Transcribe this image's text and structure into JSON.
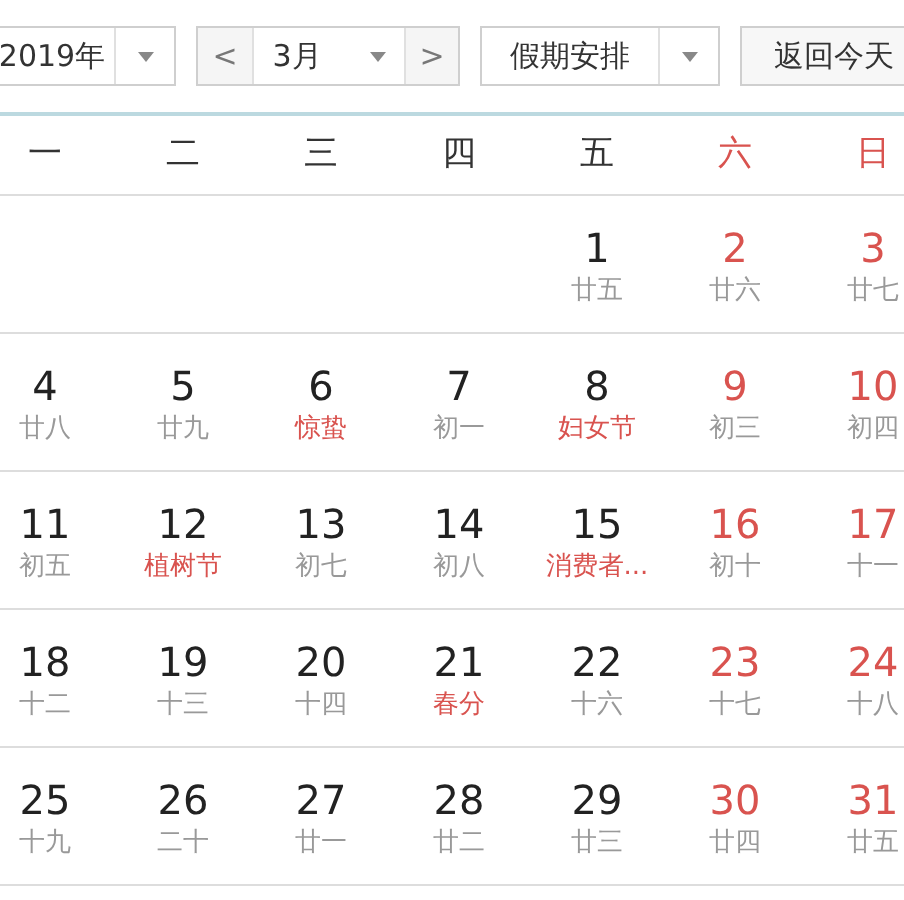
{
  "toolbar": {
    "year": "2019年",
    "prev": "<",
    "month": "3月",
    "next": ">",
    "holiday_select": "假期安排",
    "today_button": "返回今天"
  },
  "weekdays": [
    {
      "label": "一",
      "weekend": false
    },
    {
      "label": "二",
      "weekend": false
    },
    {
      "label": "三",
      "weekend": false
    },
    {
      "label": "四",
      "weekend": false
    },
    {
      "label": "五",
      "weekend": false
    },
    {
      "label": "六",
      "weekend": true
    },
    {
      "label": "日",
      "weekend": true
    }
  ],
  "weeks": [
    [
      {
        "kind": "blank"
      },
      {
        "kind": "blank"
      },
      {
        "kind": "blank"
      },
      {
        "kind": "blank"
      },
      {
        "kind": "day",
        "day": "1",
        "lunar": "廿五",
        "weekend": false,
        "festival": false
      },
      {
        "kind": "day",
        "day": "2",
        "lunar": "廿六",
        "weekend": true,
        "festival": false
      },
      {
        "kind": "day",
        "day": "3",
        "lunar": "廿七",
        "weekend": true,
        "festival": false
      }
    ],
    [
      {
        "kind": "day",
        "day": "4",
        "lunar": "廿八",
        "weekend": false,
        "festival": false
      },
      {
        "kind": "day",
        "day": "5",
        "lunar": "廿九",
        "weekend": false,
        "festival": false
      },
      {
        "kind": "day",
        "day": "6",
        "lunar": "惊蛰",
        "weekend": false,
        "festival": true
      },
      {
        "kind": "day",
        "day": "7",
        "lunar": "初一",
        "weekend": false,
        "festival": false
      },
      {
        "kind": "day",
        "day": "8",
        "lunar": "妇女节",
        "weekend": false,
        "festival": true
      },
      {
        "kind": "day",
        "day": "9",
        "lunar": "初三",
        "weekend": true,
        "festival": false
      },
      {
        "kind": "day",
        "day": "10",
        "lunar": "初四",
        "weekend": true,
        "festival": false
      }
    ],
    [
      {
        "kind": "day",
        "day": "11",
        "lunar": "初五",
        "weekend": false,
        "festival": false
      },
      {
        "kind": "day",
        "day": "12",
        "lunar": "植树节",
        "weekend": false,
        "festival": true
      },
      {
        "kind": "day",
        "day": "13",
        "lunar": "初七",
        "weekend": false,
        "festival": false
      },
      {
        "kind": "day",
        "day": "14",
        "lunar": "初八",
        "weekend": false,
        "festival": false
      },
      {
        "kind": "day",
        "day": "15",
        "lunar": "消费者...",
        "weekend": false,
        "festival": true
      },
      {
        "kind": "day",
        "day": "16",
        "lunar": "初十",
        "weekend": true,
        "festival": false
      },
      {
        "kind": "day",
        "day": "17",
        "lunar": "十一",
        "weekend": true,
        "festival": false
      }
    ],
    [
      {
        "kind": "day",
        "day": "18",
        "lunar": "十二",
        "weekend": false,
        "festival": false
      },
      {
        "kind": "day",
        "day": "19",
        "lunar": "十三",
        "weekend": false,
        "festival": false
      },
      {
        "kind": "day",
        "day": "20",
        "lunar": "十四",
        "weekend": false,
        "festival": false
      },
      {
        "kind": "day",
        "day": "21",
        "lunar": "春分",
        "weekend": false,
        "festival": true
      },
      {
        "kind": "day",
        "day": "22",
        "lunar": "十六",
        "weekend": false,
        "festival": false
      },
      {
        "kind": "day",
        "day": "23",
        "lunar": "十七",
        "weekend": true,
        "festival": false
      },
      {
        "kind": "day",
        "day": "24",
        "lunar": "十八",
        "weekend": true,
        "festival": false
      }
    ],
    [
      {
        "kind": "day",
        "day": "25",
        "lunar": "十九",
        "weekend": false,
        "festival": false
      },
      {
        "kind": "day",
        "day": "26",
        "lunar": "二十",
        "weekend": false,
        "festival": false
      },
      {
        "kind": "day",
        "day": "27",
        "lunar": "廿一",
        "weekend": false,
        "festival": false
      },
      {
        "kind": "day",
        "day": "28",
        "lunar": "廿二",
        "weekend": false,
        "festival": false
      },
      {
        "kind": "day",
        "day": "29",
        "lunar": "廿三",
        "weekend": false,
        "festival": false
      },
      {
        "kind": "day",
        "day": "30",
        "lunar": "廿四",
        "weekend": true,
        "festival": false
      },
      {
        "kind": "day",
        "day": "31",
        "lunar": "廿五",
        "weekend": true,
        "festival": false
      }
    ]
  ]
}
